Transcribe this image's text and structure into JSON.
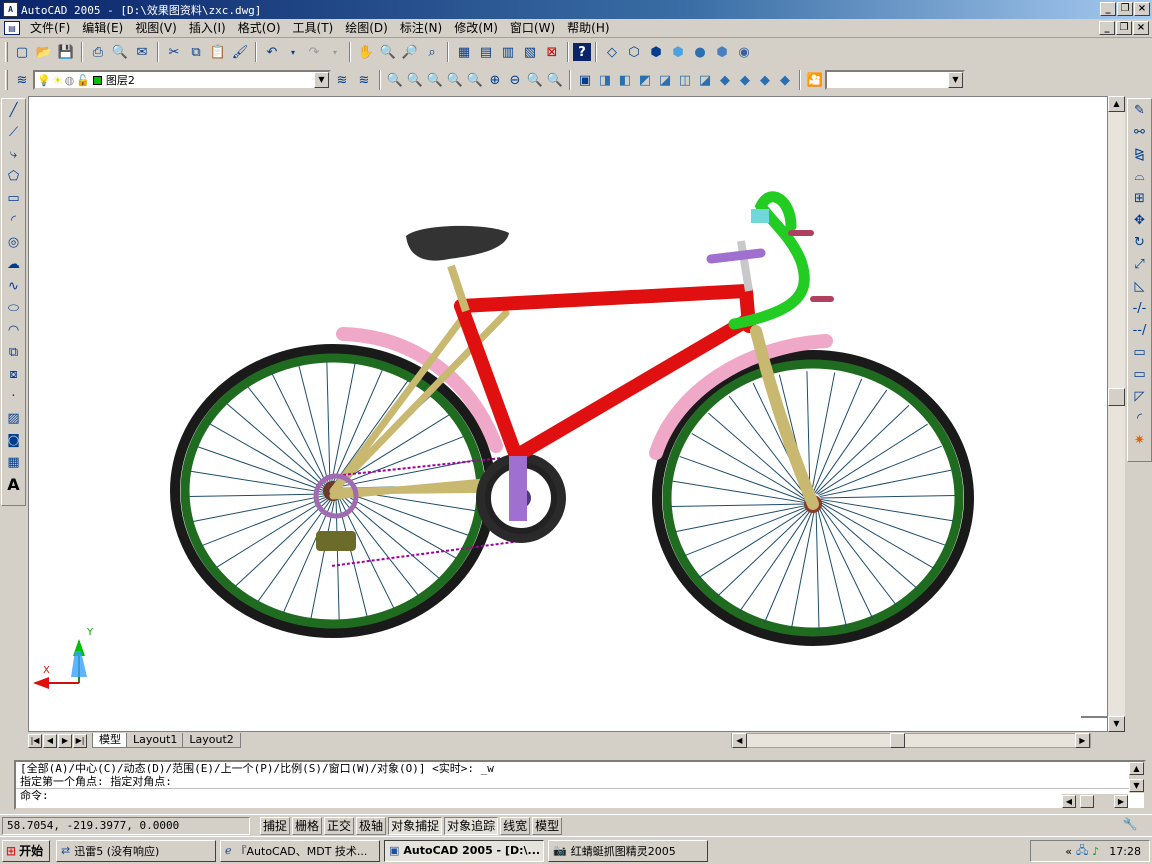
{
  "window": {
    "title": "AutoCAD 2005 - [D:\\效果图资料\\zxc.dwg]",
    "app_icon": "autocad-icon"
  },
  "menu": {
    "items": [
      "文件(F)",
      "编辑(E)",
      "视图(V)",
      "插入(I)",
      "格式(O)",
      "工具(T)",
      "绘图(D)",
      "标注(N)",
      "修改(M)",
      "窗口(W)",
      "帮助(H)"
    ]
  },
  "layer": {
    "current": "图层2"
  },
  "layout_tabs": [
    "模型",
    "Layout1",
    "Layout2"
  ],
  "command": {
    "line1": "[全部(A)/中心(C)/动态(D)/范围(E)/上一个(P)/比例(S)/窗口(W)/对象(O)] <实时>: _w",
    "line2": "指定第一个角点: 指定对角点:",
    "prompt": "命令:"
  },
  "status": {
    "coords": "58.7054,  -219.3977, 0.0000",
    "toggles": [
      {
        "label": "捕捉",
        "on": false
      },
      {
        "label": "栅格",
        "on": false
      },
      {
        "label": "正交",
        "on": false
      },
      {
        "label": "极轴",
        "on": false
      },
      {
        "label": "对象捕捉",
        "on": true
      },
      {
        "label": "对象追踪",
        "on": true
      },
      {
        "label": "线宽",
        "on": false
      },
      {
        "label": "模型",
        "on": false
      }
    ]
  },
  "ucs": {
    "x_label": "X",
    "y_label": "Y"
  },
  "taskbar": {
    "start": "开始",
    "items": [
      {
        "label": "迅雷5 (没有响应)",
        "active": false
      },
      {
        "label": "『AutoCAD、MDT 技术...",
        "active": false
      },
      {
        "label": "AutoCAD 2005 - [D:\\...",
        "active": true
      },
      {
        "label": "红蜻蜓抓图精灵2005",
        "active": false
      }
    ],
    "clock": "17:28"
  },
  "colors": {
    "frame_red": "#e01010",
    "tire": "#1a1a1a",
    "rim_green": "#1f6b1f",
    "fender_pink": "#f0a8c8",
    "handlebar_green": "#22cc22",
    "fork_gold": "#c8b870"
  }
}
